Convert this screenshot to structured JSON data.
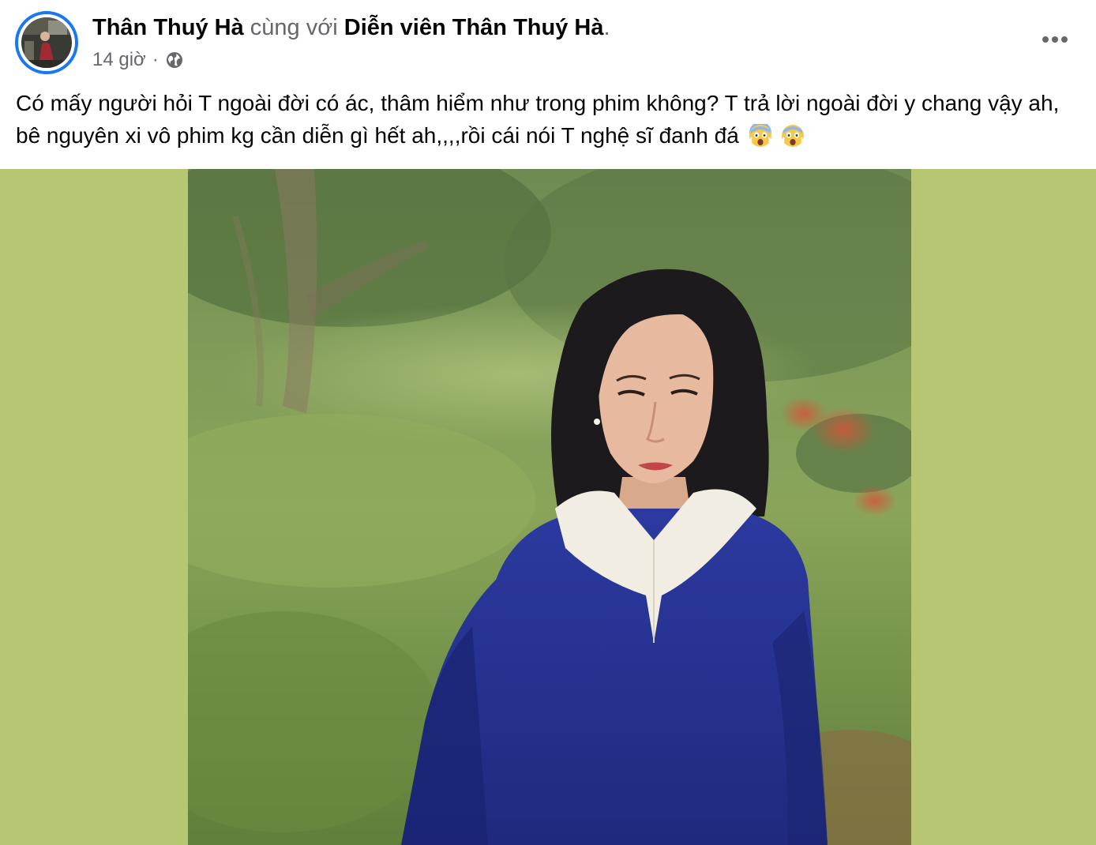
{
  "post": {
    "author_name": "Thân Thuý Hà",
    "with_text": "cùng với",
    "tagged_name": "Diễn viên Thân Thuý Hà",
    "tagged_suffix": ".",
    "timestamp": "14 giờ",
    "separator": "·",
    "privacy_icon": "globe-icon",
    "more_icon": "more-options-icon",
    "text": "Có mấy người hỏi T ngoài đời có ác, thâm hiểm như trong phim không? T trả lời ngoài đời y chang vậy ah, bê nguyên xi vô phim kg cần diễn gì hết ah,,,,rồi cái nói T nghệ sĩ đanh đá",
    "emojis": [
      "face-screaming-icon",
      "face-screaming-icon"
    ]
  },
  "colors": {
    "accent": "#1877f2",
    "text_primary": "#050505",
    "text_secondary": "#65676b",
    "media_background": "#b6c673"
  }
}
